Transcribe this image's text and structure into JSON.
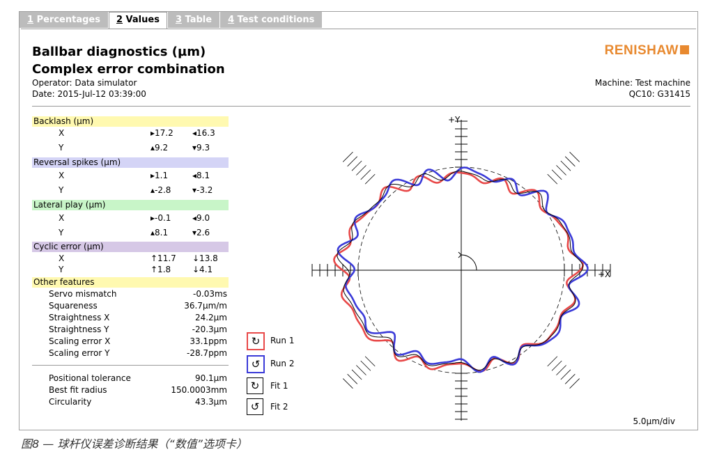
{
  "tabs": [
    {
      "num": "1",
      "label": " Percentages",
      "active": false
    },
    {
      "num": "2",
      "label": " Values",
      "active": true
    },
    {
      "num": "3",
      "label": " Table",
      "active": false
    },
    {
      "num": "4",
      "label": " Test conditions",
      "active": false
    }
  ],
  "header": {
    "title": "Ballbar diagnostics (µm)",
    "subtitle": "Complex error combination",
    "operator": "Operator: Data simulator",
    "date": "Date: 2015-Jul-12 03:39:00",
    "logo": "RENISHAW",
    "machine": "Machine: Test machine",
    "qc10": "QC10: G31415"
  },
  "sections": {
    "backlash": "Backlash (µm)",
    "reversal": "Reversal spikes (µm)",
    "lateral": "Lateral play (µm)",
    "cyclic": "Cyclic error (µm)",
    "other": "Other features"
  },
  "values": {
    "backlash_x": [
      "X",
      "▸17.2",
      "◂16.3"
    ],
    "backlash_y": [
      "Y",
      "▴9.2",
      "▾9.3"
    ],
    "reversal_x": [
      "X",
      "▸1.1",
      "◂8.1"
    ],
    "reversal_y": [
      "Y",
      "▴-2.8",
      "▾-3.2"
    ],
    "lateral_x": [
      "X",
      "▸-0.1",
      "◂9.0"
    ],
    "lateral_y": [
      "Y",
      "▴8.1",
      "▾2.6"
    ],
    "cyclic_x": [
      "X",
      "↑11.7",
      "↓13.8"
    ],
    "cyclic_y": [
      "Y",
      "↑1.8",
      "↓4.1"
    ]
  },
  "features": [
    {
      "label": "Servo mismatch",
      "value": "-0.03ms"
    },
    {
      "label": "Squareness",
      "value": "36.7µm/m"
    },
    {
      "label": "Straightness X",
      "value": "24.2µm"
    },
    {
      "label": "Straightness Y",
      "value": "-20.3µm"
    },
    {
      "label": "Scaling error X",
      "value": "33.1ppm"
    },
    {
      "label": "Scaling error Y",
      "value": "-28.7ppm"
    }
  ],
  "summary": [
    {
      "label": "Positional tolerance",
      "value": "90.1µm"
    },
    {
      "label": "Best fit radius",
      "value": "150.0003mm"
    },
    {
      "label": "Circularity",
      "value": "43.3µm"
    }
  ],
  "legend": [
    {
      "label": "Run 1",
      "color": "#e84848",
      "icon": "clockwise-arrow-icon"
    },
    {
      "label": "Run 2",
      "color": "#3a3ad8",
      "icon": "counterclockwise-arrow-icon"
    },
    {
      "label": "Fit 1",
      "color": "#000000",
      "icon": "clockwise-arrow-icon"
    },
    {
      "label": "Fit 2",
      "color": "#000000",
      "icon": "counterclockwise-arrow-icon"
    }
  ],
  "plot": {
    "x_axis_label": "+X",
    "y_axis_label": "+Y",
    "scale": "5.0µm/div",
    "colors": {
      "run1": "#e84848",
      "run2": "#3a3ad8",
      "fit": "#000000"
    }
  },
  "section_colors": {
    "backlash": "#fff9b0",
    "reversal": "#d4d4f6",
    "lateral": "#c8f5c8",
    "cyclic": "#d6c8e6",
    "other": "#fff9b0"
  },
  "caption": "图8 — 球杆仪误差诊断结果（“数值”选项卡）"
}
